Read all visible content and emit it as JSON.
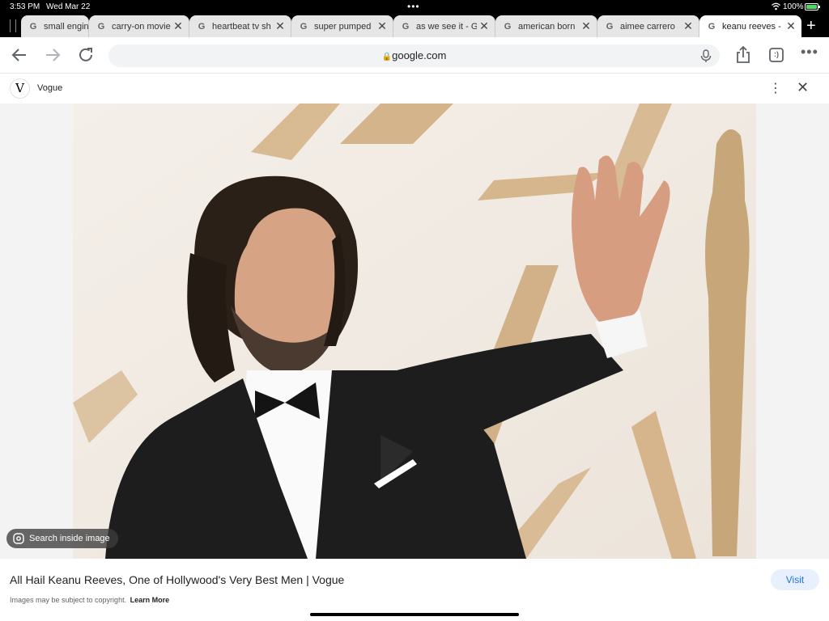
{
  "status_bar": {
    "time": "3:53 PM",
    "date": "Wed Mar 22",
    "battery": "100%",
    "battery_level": 1.0
  },
  "tabs": [
    {
      "label": "small engin",
      "icon": "google-g-icon",
      "active": false
    },
    {
      "label": "carry-on movie",
      "icon": "google-g-icon",
      "active": false
    },
    {
      "label": "heartbeat tv sh",
      "icon": "google-g-icon",
      "active": false
    },
    {
      "label": "super pumped",
      "icon": "google-g-icon",
      "active": false
    },
    {
      "label": "as we see it - G",
      "icon": "google-g-icon",
      "active": false
    },
    {
      "label": "american born",
      "icon": "google-g-icon",
      "active": false
    },
    {
      "label": "aimee carrero",
      "icon": "google-g-icon",
      "active": false
    },
    {
      "label": "keanu reeves -",
      "icon": "google-g-icon",
      "active": true
    }
  ],
  "toolbar": {
    "url": "google.com",
    "tab_count": ":)"
  },
  "source": {
    "logo_letter": "V",
    "name": "Vogue"
  },
  "viewer": {
    "search_inside_label": "Search inside image"
  },
  "result": {
    "title": "All Hail Keanu Reeves, One of Hollywood's Very Best Men | Vogue",
    "visit_label": "Visit",
    "copyright_text": "Images may be subject to copyright.",
    "learn_more_label": "Learn More"
  },
  "colors": {
    "accent": "#1a73e8",
    "visit_bg": "#e8f0fe",
    "battery": "#4cd964"
  }
}
